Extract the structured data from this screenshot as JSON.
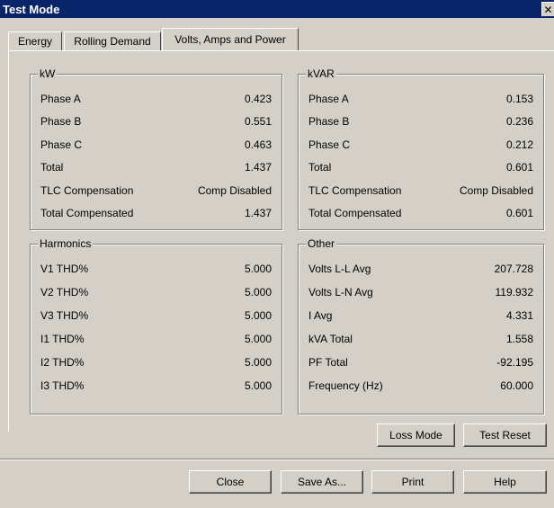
{
  "window": {
    "title": "Test Mode",
    "close_glyph": "✕"
  },
  "tabs": [
    {
      "label": "Energy"
    },
    {
      "label": "Rolling Demand"
    },
    {
      "label": "Volts, Amps and Power"
    }
  ],
  "groups": {
    "kw": {
      "title": "kW",
      "rows": [
        {
          "label": "Phase A",
          "value": "0.423"
        },
        {
          "label": "Phase B",
          "value": "0.551"
        },
        {
          "label": "Phase C",
          "value": "0.463"
        },
        {
          "label": "Total",
          "value": "1.437"
        },
        {
          "label": "TLC Compensation",
          "value": "Comp Disabled"
        },
        {
          "label": "Total Compensated",
          "value": "1.437"
        }
      ]
    },
    "kvar": {
      "title": "kVAR",
      "rows": [
        {
          "label": "Phase A",
          "value": "0.153"
        },
        {
          "label": "Phase B",
          "value": "0.236"
        },
        {
          "label": "Phase C",
          "value": "0.212"
        },
        {
          "label": "Total",
          "value": "0.601"
        },
        {
          "label": "TLC Compensation",
          "value": "Comp Disabled"
        },
        {
          "label": "Total Compensated",
          "value": "0.601"
        }
      ]
    },
    "harmonics": {
      "title": "Harmonics",
      "rows": [
        {
          "label": "V1 THD%",
          "value": "5.000"
        },
        {
          "label": "V2 THD%",
          "value": "5.000"
        },
        {
          "label": "V3 THD%",
          "value": "5.000"
        },
        {
          "label": "I1 THD%",
          "value": "5.000"
        },
        {
          "label": "I2 THD%",
          "value": "5.000"
        },
        {
          "label": "I3 THD%",
          "value": "5.000"
        }
      ]
    },
    "other": {
      "title": "Other",
      "rows": [
        {
          "label": "Volts L-L Avg",
          "value": "207.728"
        },
        {
          "label": "Volts L-N Avg",
          "value": "119.932"
        },
        {
          "label": "I Avg",
          "value": "4.331"
        },
        {
          "label": "kVA Total",
          "value": "1.558"
        },
        {
          "label": "PF Total",
          "value": "-92.195"
        },
        {
          "label": "Frequency (Hz)",
          "value": "60.000"
        }
      ]
    }
  },
  "panel_buttons": {
    "loss_mode": "Loss Mode",
    "test_reset": "Test Reset"
  },
  "footer_buttons": {
    "close": "Close",
    "save_as": "Save As...",
    "print": "Print",
    "help": "Help"
  }
}
